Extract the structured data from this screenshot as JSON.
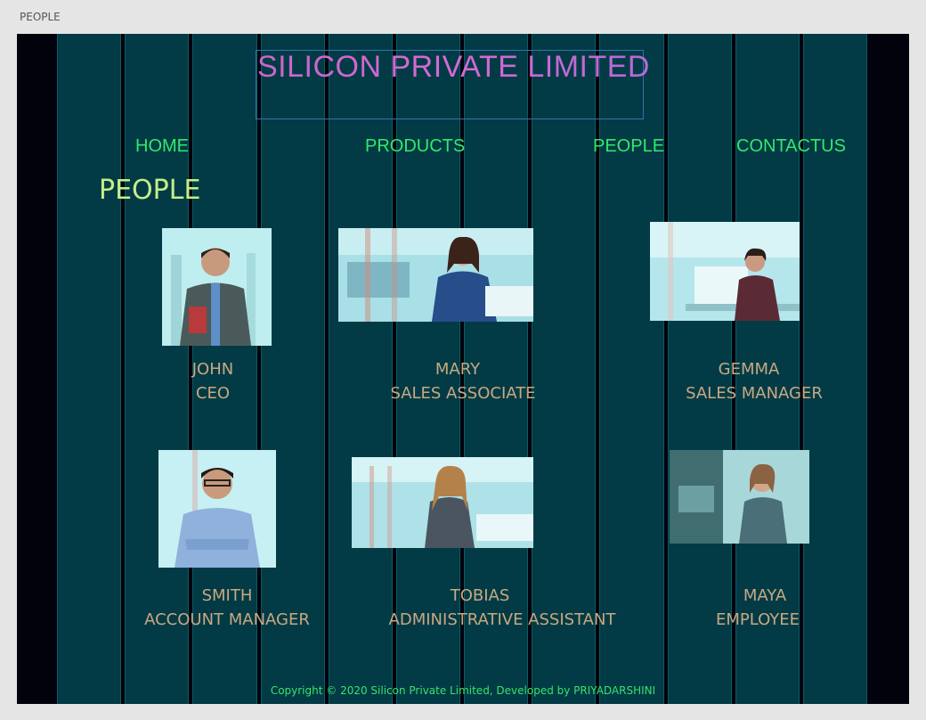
{
  "window": {
    "title": "PEOPLE"
  },
  "header": {
    "brand": "SILICON PRIVATE LIMITED"
  },
  "nav": {
    "home": "HOME",
    "products": "PRODUCTS",
    "people": "PEOPLE",
    "contactus": "CONTACTUS"
  },
  "page": {
    "heading": "PEOPLE"
  },
  "people": [
    {
      "name": "JOHN",
      "role": "CEO"
    },
    {
      "name": "MARY",
      "role": "SALES ASSOCIATE"
    },
    {
      "name": "GEMMA",
      "role": "SALES MANAGER"
    },
    {
      "name": "SMITH",
      "role": "ACCOUNT MANAGER"
    },
    {
      "name": "TOBIAS",
      "role": "ADMINISTRATIVE ASSISTANT"
    },
    {
      "name": "MAYA",
      "role": "EMPLOYEE"
    }
  ],
  "footer": {
    "copyright": "Copyright © 2020 Silicon Private Limited, Developed by PRIYADARSHINI"
  },
  "colors": {
    "background": "#02020c",
    "column": "#023b45",
    "nav": "#33e86a",
    "heading": "#c4ee88",
    "person_text": "#c8a882",
    "brand": "#c966c9"
  }
}
